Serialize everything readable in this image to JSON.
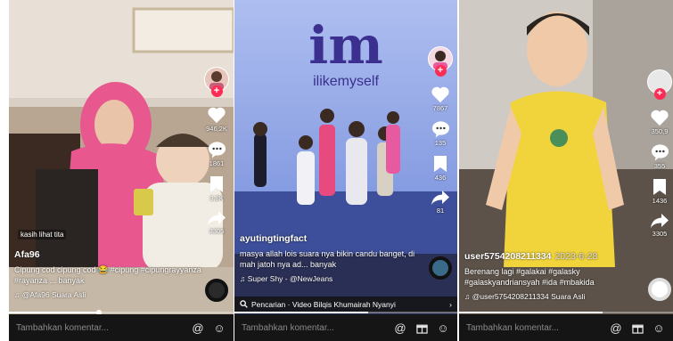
{
  "panels": [
    {
      "author": "Afa96",
      "date": "",
      "sticker": "kasih lihat tita",
      "caption": "Cipung cod cipung cod 😂 #cipung #cipungrayyanza #rayanza ... banyak",
      "music": "♫ @Afa96 Suara Asli",
      "likes": "946,2K",
      "comments": "1861",
      "saves": "3,8K",
      "shares": "3305",
      "comment_placeholder": "Tambahkan komentar...",
      "progress": 0.4
    },
    {
      "logo_mark": "im",
      "logo_text": "ilikemyself",
      "author": "ayutingtingfact",
      "caption": "masya allah lois suara nya bikin candu banget, di mah jatoh nya ad... banyak",
      "music": "♫ Super Shy - @NewJeans",
      "likes": "7867",
      "comments": "135",
      "saves": "436",
      "shares": "81",
      "search_text": "Pencarian · Video Bilqis Khumairah Nyanyi",
      "comment_placeholder": "Tambahkan komentar...",
      "progress": 0.6
    },
    {
      "author": "user5754208211334",
      "date": "2023-6-28",
      "caption": "Berenang lagi #galakai #galasky #galaskyandriansyah #ida #mbakida",
      "music": "♫ @user5754208211334 Suara Asli",
      "likes": "350,9",
      "comments": "355",
      "saves": "1436",
      "shares": "3305",
      "comment_placeholder": "Tambahkan komentar...",
      "progress": 0.67
    }
  ],
  "icons": {
    "like": "heart-icon",
    "comment": "comment-icon",
    "save": "bookmark-icon",
    "share": "share-icon",
    "mention": "at-icon",
    "emoji": "emoji-icon",
    "gift": "gift-icon",
    "search": "search-icon"
  },
  "colors": {
    "accent": "#fe2c55",
    "hijab": "#e8588f",
    "stage": "#6c86d8",
    "logo": "#3b2f8f",
    "shirt": "#f1d43c"
  }
}
